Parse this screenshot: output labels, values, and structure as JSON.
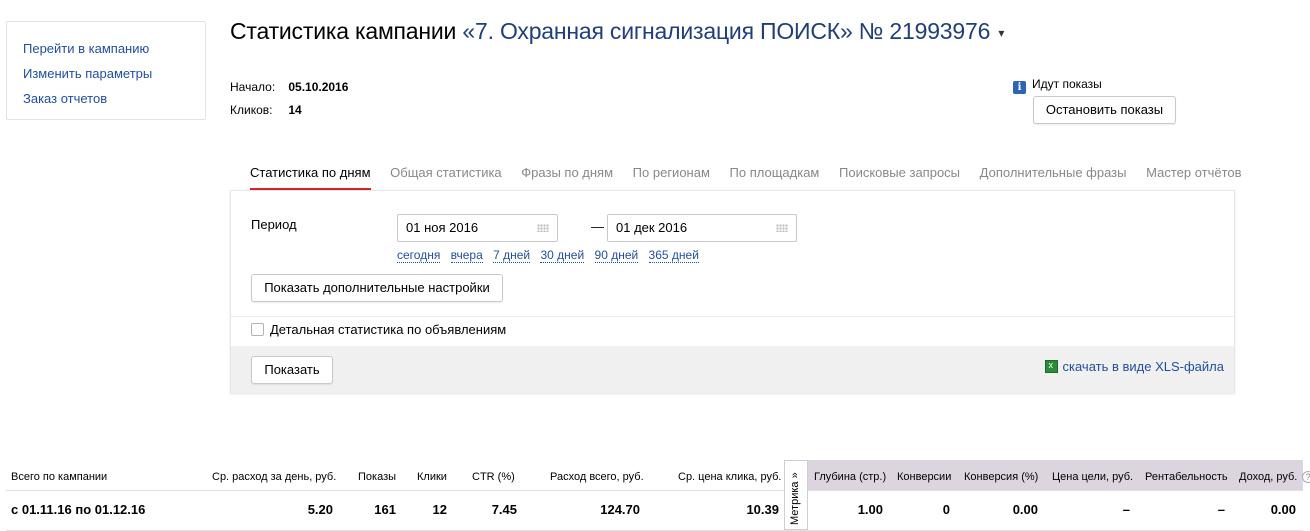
{
  "sidebar": {
    "links": [
      "Перейти в кампанию",
      "Изменить параметры",
      "Заказ отчетов"
    ]
  },
  "header": {
    "title_prefix": "Статистика кампании",
    "campaign": "«7. Охранная сигнализация ПОИСК» № 21993976",
    "caret": "▾"
  },
  "meta": {
    "start_label": "Начало:",
    "start_value": "05.10.2016",
    "clicks_label": "Кликов:",
    "clicks_value": "14"
  },
  "status": {
    "text": "Идут показы",
    "stop_button": "Остановить показы"
  },
  "tabs": [
    "Статистика по дням",
    "Общая статистика",
    "Фразы по дням",
    "По регионам",
    "По площадкам",
    "Поисковые запросы",
    "Дополнительные фразы",
    "Мастер отчётов"
  ],
  "filter": {
    "period_label": "Период",
    "date_from": "01 ноя 2016",
    "date_to": "01 дек 2016",
    "dash": "—",
    "quick_ranges": [
      "сегодня",
      "вчера",
      "7 дней",
      "30 дней",
      "90 дней",
      "365 дней"
    ],
    "advanced_button": "Показать дополнительные настройки",
    "detail_checkbox": "Детальная статистика по объявлениям",
    "show_button": "Показать",
    "xls_link": "скачать в виде XLS-файла"
  },
  "table": {
    "metrika_label": "Метрика »",
    "headers": [
      "Всего по кампании",
      "Ср. расход за день, руб.",
      "Показы",
      "Клики",
      "CTR (%)",
      "Расход всего, руб.",
      "Ср. цена клика, руб.",
      "Глубина (стр.)",
      "Конверсии",
      "Конверсия (%)",
      "Цена цели, руб.",
      "Рентабельность",
      "Доход, руб."
    ],
    "row": [
      "с 01.11.16 по 01.12.16",
      "5.20",
      "161",
      "12",
      "7.45",
      "124.70",
      "10.39",
      "1.00",
      "0",
      "0.00",
      "–",
      "–",
      "0.00"
    ]
  },
  "colors": {
    "link": "#1f4e9e",
    "active_tab_underline": "#d6232a",
    "metrika_header_bg": "#dcd5e0",
    "footer_bg": "#f0f0f0"
  }
}
